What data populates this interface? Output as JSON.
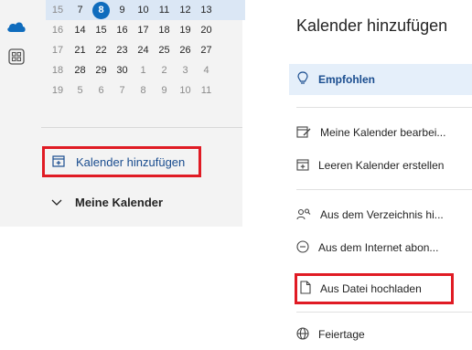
{
  "colors": {
    "accent": "#0f6cbd",
    "highlight_border": "#e01b24",
    "selected_bg": "#e5effa",
    "current_week_bg": "#dbe7f5"
  },
  "left_rail": {
    "icons": [
      "onedrive-cloud-icon",
      "apps-icon"
    ]
  },
  "mini_calendar": {
    "weeks": [
      {
        "week": "15",
        "days": [
          "7",
          "8",
          "9",
          "10",
          "11",
          "12",
          "13"
        ],
        "current": true,
        "today_index": 1
      },
      {
        "week": "16",
        "days": [
          "14",
          "15",
          "16",
          "17",
          "18",
          "19",
          "20"
        ]
      },
      {
        "week": "17",
        "days": [
          "21",
          "22",
          "23",
          "24",
          "25",
          "26",
          "27"
        ]
      },
      {
        "week": "18",
        "days": [
          "28",
          "29",
          "30",
          "1",
          "2",
          "3",
          "4"
        ],
        "muted_from": 3
      },
      {
        "week": "19",
        "days": [
          "5",
          "6",
          "7",
          "8",
          "9",
          "10",
          "11"
        ],
        "muted_from": 0
      }
    ]
  },
  "add_calendar_button": {
    "label": "Kalender hinzufügen",
    "icon": "calendar-add-icon"
  },
  "my_calendars": {
    "label": "Meine Kalender",
    "icon": "chevron-down-icon"
  },
  "dialog": {
    "title": "Kalender hinzufügen",
    "items": [
      {
        "label": "Empfohlen",
        "icon": "lightbulb-icon"
      },
      {
        "label": "Meine Kalender bearbei...",
        "icon": "edit-calendar-icon"
      },
      {
        "label": "Leeren Kalender erstellen",
        "icon": "calendar-add-icon"
      },
      {
        "label": "Aus dem Verzeichnis hi...",
        "icon": "people-search-icon"
      },
      {
        "label": "Aus dem Internet abon...",
        "icon": "globe-link-icon"
      },
      {
        "label": "Aus Datei hochladen",
        "icon": "document-icon"
      },
      {
        "label": "Feiertage",
        "icon": "globe-icon"
      }
    ]
  }
}
